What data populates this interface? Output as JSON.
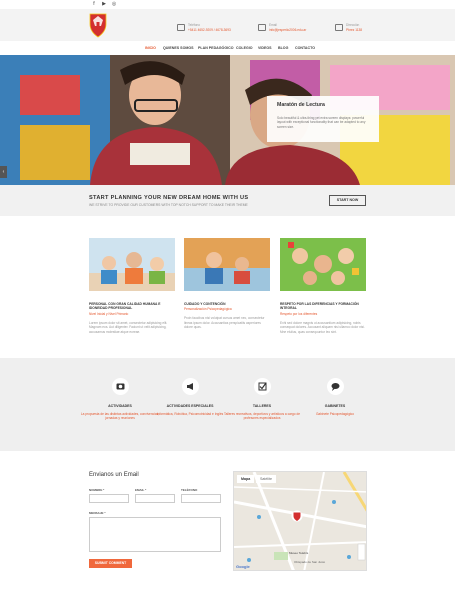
{
  "social": [
    "f",
    "▶",
    "◎"
  ],
  "header": {
    "phone_label": "Teléfono",
    "phone": "+5411 4652-9209 / 4678-3693",
    "email_label": "Email",
    "email": "info@jesperiio2006.edu.ar",
    "dir_label": "Dirección",
    "dir": "Pbrez 1138"
  },
  "nav": [
    "INICIO",
    "QUIENES SOMOS",
    "PLAN PEDAGÓGICO",
    "COLEGIO",
    "VIDEOS",
    "BLOG",
    "CONTACTO"
  ],
  "hero": {
    "title": "Maratón de Lectura",
    "text": "Solo beautiful & ultra-thing yet extra screen displays: powerful layout with exceptional functionality that can be adapted to any screen size."
  },
  "cta": {
    "title": "START PLANNING YOUR NEW DREAM HOME WITH US",
    "sub": "WE STRIVE TO PROVIDE OUR CUSTOMERS WITH TOP NOTCH SUPPORT TO MAKE THEIR THEME",
    "button": "START NOW"
  },
  "cards": [
    {
      "title": "PERSONAL CON GRAN CALIDAD HUMANA E IDONEIDAD PROFESIONAL",
      "sub": "Nivel Inicial y Nivel Primario",
      "text": "Lorem ipsum dolor sit amet, consectetur adipisicing elit. Magnam eos. Aut diligenter. Faciunt ut velit adipisicing, accusamus molestiae atque eoreae."
    },
    {
      "title": "CUIDADO Y CONTENCIÓN",
      "sub": "Personalización Psicopedagógica",
      "text": "Proin faucibus nisi volutpat cursus amet nec, consectetur lineas ipsum dolor. Accusantias perspicatiis asperiores dolore quas."
    },
    {
      "title": "RESPETO POR LAS DIFERENCIAS Y FORMACIÓN INTEGRAL",
      "sub": "Respeto por los diferentes",
      "text": "Exhi sed dolore magnis ut accusantium adipisicing, nobis consequat dolores. Accusant aliquam nisi ullamco dolor nisi. Mne elulius, quas consequuntur leo sint."
    }
  ],
  "features": [
    {
      "icon": "camera-icon",
      "glyph": "◘",
      "title": "ACTIVIDADES",
      "text": "La propuesta de las distintas actividades, convivencias, jornadas y reuniones"
    },
    {
      "icon": "megaphone-icon",
      "glyph": "◉",
      "title": "ACTIVIDADES ESPECIALES",
      "text": "Informática, Robótica, Psicomotricidad e Inglés"
    },
    {
      "icon": "checkbox-icon",
      "glyph": "☑",
      "title": "TALLERES",
      "text": "Talleres recreativos, deportivos y artísticos a cargo de profesores especializados"
    },
    {
      "icon": "chat-icon",
      "glyph": "●",
      "title": "GABINETES",
      "text": "Gabinete Psicopedagógico"
    }
  ],
  "form": {
    "title": "Envianos un Email",
    "nombre": "NOMBRE *",
    "email": "EMAIL *",
    "telefono": "TELÉFONO",
    "mensaje": "MENSAJE *",
    "submit": "SUBMIT COMMENT"
  },
  "map": {
    "tab1": "Mapa",
    "tab2": "Satélite",
    "place1": "Museo Telebís",
    "place2": "Obispado de San Justo",
    "google": "Google"
  }
}
